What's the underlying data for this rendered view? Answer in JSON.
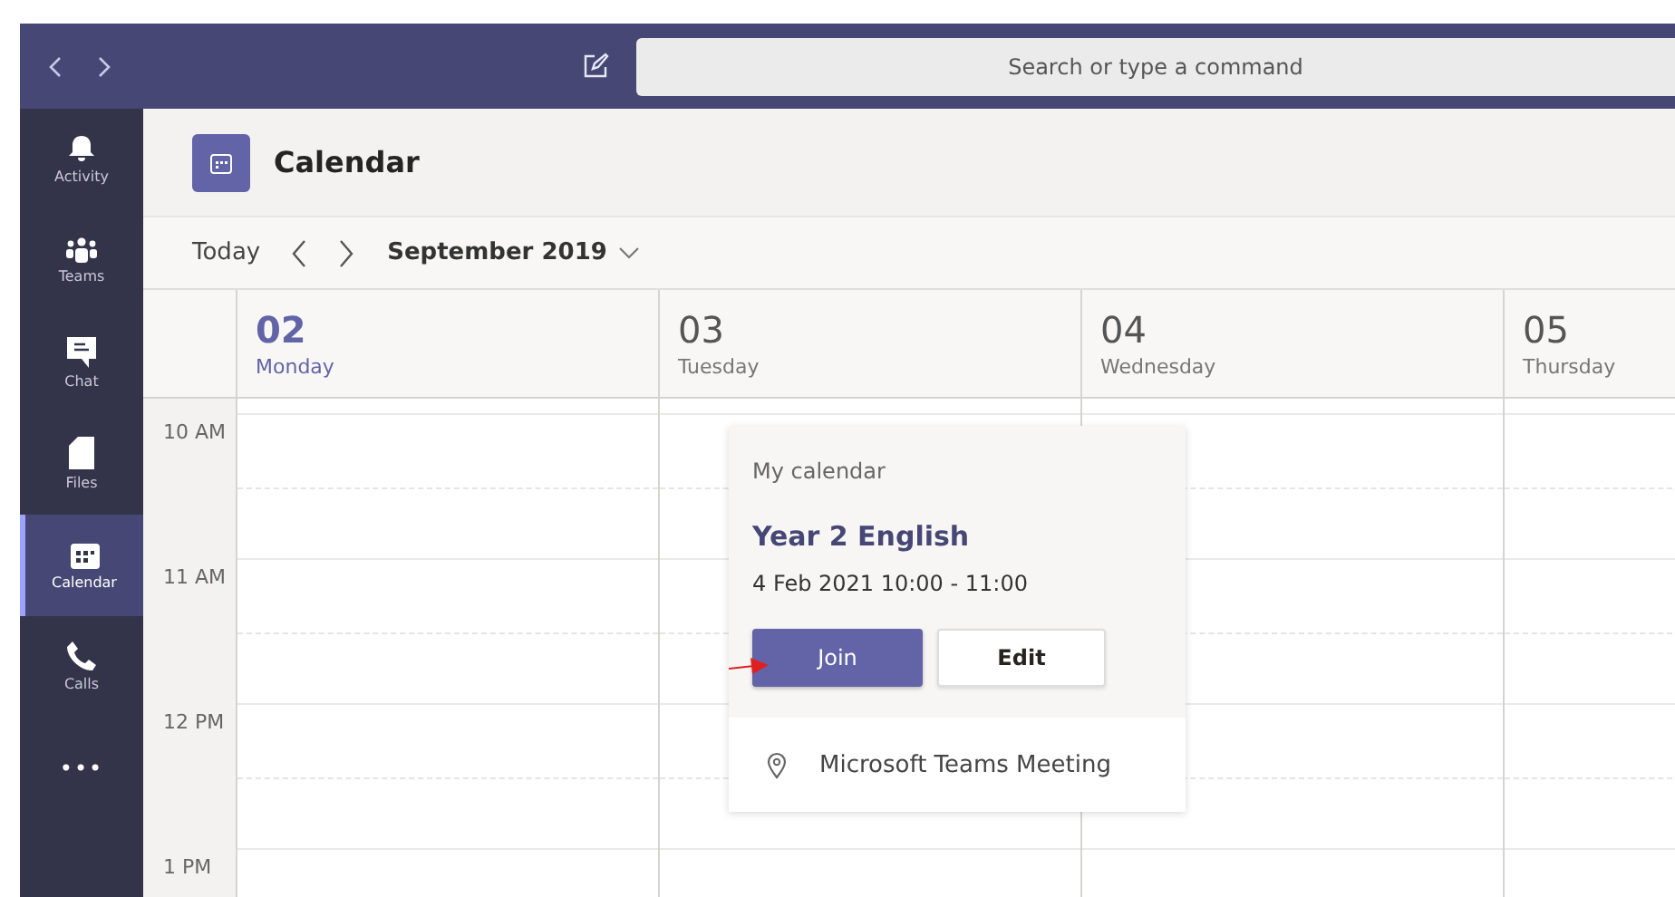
{
  "search": {
    "placeholder": "Search or type a command"
  },
  "sidebar": {
    "items": [
      {
        "kind": "bell",
        "label": "Activity",
        "selected": false
      },
      {
        "kind": "teams",
        "label": "Teams",
        "selected": false
      },
      {
        "kind": "chat",
        "label": "Chat",
        "selected": false
      },
      {
        "kind": "files",
        "label": "Files",
        "selected": false
      },
      {
        "kind": "calendar",
        "label": "Calendar",
        "selected": true
      },
      {
        "kind": "calls",
        "label": "Calls",
        "selected": false
      },
      {
        "kind": "more",
        "label": "•••",
        "selected": false
      }
    ]
  },
  "header": {
    "title": "Calendar"
  },
  "toolbar": {
    "today": "Today",
    "month": "September 2019"
  },
  "days": [
    {
      "date": "02",
      "weekday": "Monday",
      "selected": true
    },
    {
      "date": "03",
      "weekday": "Tuesday",
      "selected": false
    },
    {
      "date": "04",
      "weekday": "Wednesday",
      "selected": false
    },
    {
      "date": "05",
      "weekday": "Thursday",
      "selected": false
    }
  ],
  "hours": [
    "10 AM",
    "11 AM",
    "12 PM",
    "1 PM"
  ],
  "popup": {
    "calendar": "My calendar",
    "title": "Year 2 English",
    "time": "4 Feb 2021 10:00 - 11:00",
    "buttons": [
      {
        "label": "Join",
        "kind": "primary"
      },
      {
        "label": "Edit",
        "kind": "secondary"
      }
    ],
    "location": "Microsoft Teams Meeting"
  }
}
